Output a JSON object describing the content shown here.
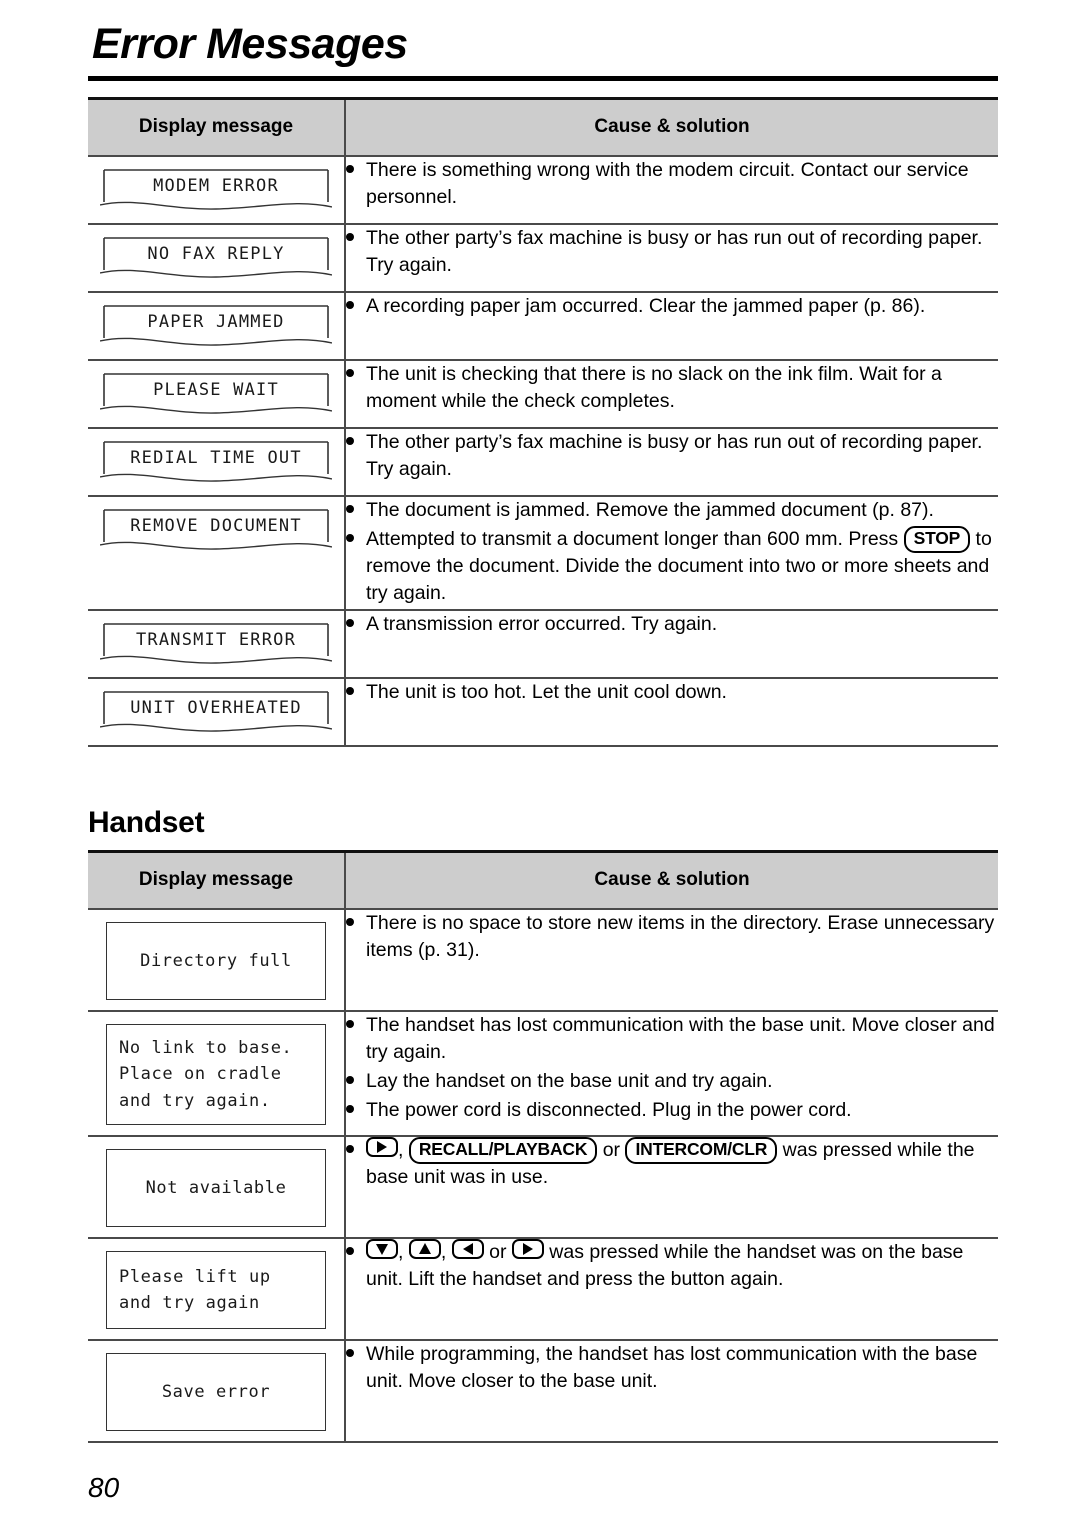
{
  "page": {
    "title": "Error Messages",
    "number": "80"
  },
  "sections": [
    {
      "id": "error-messages",
      "heading": null,
      "columns": {
        "display": "Display message",
        "cause": "Cause & solution"
      },
      "box_style": "torn",
      "rows": [
        {
          "display": "MODEM ERROR",
          "bullets": [
            {
              "text": "There is something wrong with the modem circuit. Contact our service personnel."
            }
          ]
        },
        {
          "display": "NO FAX REPLY",
          "bullets": [
            {
              "text": "The other party’s fax machine is busy or has run out of recording paper. Try again."
            }
          ]
        },
        {
          "display": "PAPER JAMMED",
          "bullets": [
            {
              "text": "A recording paper jam occurred. Clear the jammed paper (p. 86)."
            }
          ]
        },
        {
          "display": "PLEASE WAIT",
          "bullets": [
            {
              "text": "The unit is checking that there is no slack on the ink film. Wait for a moment while the check completes."
            }
          ]
        },
        {
          "display": "REDIAL TIME OUT",
          "bullets": [
            {
              "text": "The other party’s fax machine is busy or has run out of recording paper. Try again."
            }
          ]
        },
        {
          "display": "REMOVE DOCUMENT",
          "bullets": [
            {
              "text": "The document is jammed. Remove the jammed document (p. 87)."
            },
            {
              "pre": "Attempted to transmit a document longer than 600 mm. Press ",
              "key": "STOP",
              "post": " to remove the document. Divide the document into two or more sheets and try again."
            }
          ]
        },
        {
          "display": "TRANSMIT ERROR",
          "bullets": [
            {
              "text": "A transmission error occurred. Try again."
            }
          ]
        },
        {
          "display": "UNIT OVERHEATED",
          "bullets": [
            {
              "text": "The unit is too hot. Let the unit cool down."
            }
          ]
        }
      ]
    },
    {
      "id": "handset",
      "heading": "Handset",
      "columns": {
        "display": "Display message",
        "cause": "Cause & solution"
      },
      "box_style": "rect",
      "rows": [
        {
          "display": "Directory full",
          "align": "center",
          "bullets": [
            {
              "text": "There is no space to store new items in the directory. Erase unnecessary items (p. 31)."
            }
          ]
        },
        {
          "display": "No link to base.\nPlace on cradle\nand try again.",
          "align": "left",
          "bullets": [
            {
              "text": "The handset has lost communication with the base unit. Move closer and try again."
            },
            {
              "text": "Lay the handset on the base unit and try again."
            },
            {
              "text": "The power cord is disconnected. Plug in the power cord."
            }
          ]
        },
        {
          "display": "Not available",
          "align": "center",
          "bullets": [
            {
              "keys_intro": [
                {
                  "type": "arrow",
                  "dir": "right"
                },
                {
                  "type": "sep",
                  "text": ", "
                },
                {
                  "type": "key",
                  "label": "RECALL/PLAYBACK"
                },
                {
                  "type": "sep",
                  "text": " or "
                },
                {
                  "type": "key",
                  "label": "INTERCOM/CLR"
                }
              ],
              "post": " was pressed while the base unit was in use."
            }
          ]
        },
        {
          "display": "Please lift up\nand try again",
          "align": "left",
          "bullets": [
            {
              "keys_intro": [
                {
                  "type": "arrow",
                  "dir": "down"
                },
                {
                  "type": "sep",
                  "text": ", "
                },
                {
                  "type": "arrow",
                  "dir": "up"
                },
                {
                  "type": "sep",
                  "text": ", "
                },
                {
                  "type": "arrow",
                  "dir": "left"
                },
                {
                  "type": "sep",
                  "text": " or "
                },
                {
                  "type": "arrow",
                  "dir": "right"
                }
              ],
              "post": " was pressed while the handset was on the base unit. Lift the handset and press the button again."
            }
          ]
        },
        {
          "display": "Save error",
          "align": "center",
          "bullets": [
            {
              "text": "While programming, the handset has lost communication with the base unit. Move closer to the base unit."
            }
          ]
        }
      ]
    }
  ]
}
